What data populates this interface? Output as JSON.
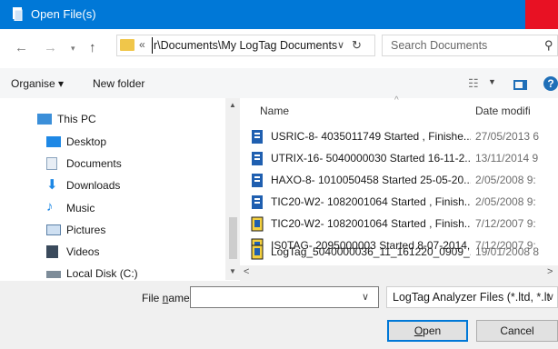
{
  "window": {
    "title": "Open File(s)"
  },
  "address": {
    "prefix": "«",
    "path": "r\\Documents\\My LogTag Documents"
  },
  "search": {
    "placeholder": "Search Documents"
  },
  "toolbar": {
    "organise": "Organise ▾",
    "new_folder": "New folder"
  },
  "nav": {
    "items": [
      {
        "label": "This PC",
        "icon": "computer-icon"
      },
      {
        "label": "Desktop",
        "icon": "desktop-icon"
      },
      {
        "label": "Documents",
        "icon": "documents-icon"
      },
      {
        "label": "Downloads",
        "icon": "downloads-icon"
      },
      {
        "label": "Music",
        "icon": "music-icon"
      },
      {
        "label": "Pictures",
        "icon": "pictures-icon"
      },
      {
        "label": "Videos",
        "icon": "videos-icon"
      },
      {
        "label": "Local Disk (C:)",
        "icon": "local-disk-icon"
      }
    ]
  },
  "columns": {
    "name": "Name",
    "date": "Date modifi"
  },
  "files": [
    {
      "name": "USRIC-8- 4035011749 Started , Finishe...",
      "date": "27/05/2013 6",
      "icon": "logtag-file-icon"
    },
    {
      "name": "UTRIX-16- 5040000030 Started 16-11-2...",
      "date": "13/11/2014 9",
      "icon": "logtag-file-icon"
    },
    {
      "name": "HAXO-8- 1010050458 Started 25-05-20...",
      "date": "2/05/2008 9:",
      "icon": "logtag-file-icon"
    },
    {
      "name": "TIC20-W2- 1082001064 Started , Finish...",
      "date": "2/05/2008 9:",
      "icon": "logtag-file-icon"
    },
    {
      "name": "TIC20-W2- 1082001064 Started , Finish...",
      "date": "7/12/2007 9:",
      "icon": "logtag-ltd-file-icon"
    },
    {
      "name": "IS0TAG- 2095000003 Started 8-07-2014,...",
      "date": "7/12/2007 9:",
      "icon": "logtag-ltd-file-icon"
    },
    {
      "name": "LogTag_5040000036_11_161220_0909_...",
      "date": "19/01/2008 8",
      "icon": "logtag-ltd-file-icon"
    }
  ],
  "footer": {
    "file_name_label_pre": "File ",
    "file_name_label_u": "n",
    "file_name_label_post": "ame:",
    "file_name_value": "",
    "file_type": "LogTag Analyzer Files (*.ltd, *.lt",
    "open_u": "O",
    "open_rest": "pen",
    "cancel": "Cancel"
  },
  "colors": {
    "accent": "#0078d7",
    "close": "#e81123",
    "folder": "#f0c64a"
  }
}
